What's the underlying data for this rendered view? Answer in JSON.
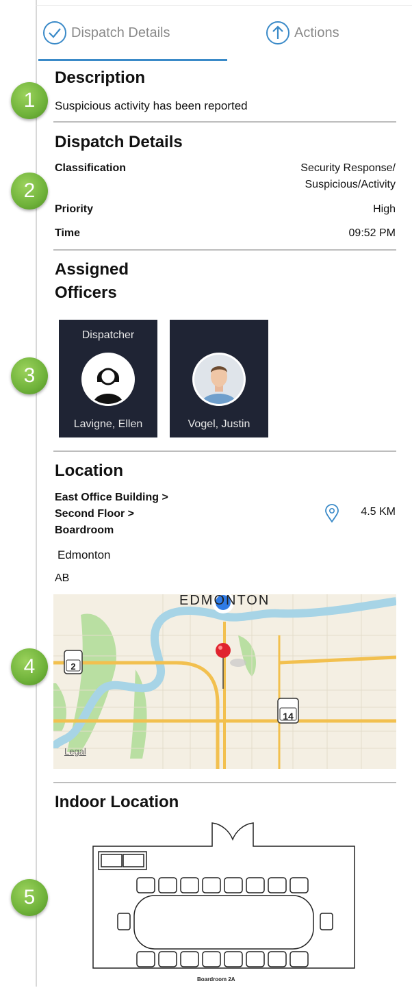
{
  "tabs": [
    {
      "label": "Dispatch Details",
      "icon": "check-circle-icon",
      "selected": true
    },
    {
      "label": "Actions",
      "icon": "arrow-up-circle-icon",
      "selected": false
    }
  ],
  "markers": [
    "1",
    "2",
    "3",
    "4",
    "5"
  ],
  "description": {
    "title": "Description",
    "text": "Suspicious activity has been reported"
  },
  "dispatch": {
    "title": "Dispatch Details",
    "classification_label": "Classification",
    "classification_value_1": "Security Response/",
    "classification_value_2": "Suspicious/Activity",
    "priority_label": "Priority",
    "priority_value": "High",
    "time_label": "Time",
    "time_value": "09:52 PM"
  },
  "officers": {
    "title_1": "Assigned",
    "title_2": "Officers",
    "list": [
      {
        "role": "Dispatcher",
        "name": "Lavigne, Ellen"
      },
      {
        "role": "",
        "name": "Vogel, Justin"
      }
    ]
  },
  "location": {
    "title": "Location",
    "path_1": "East Office Building >",
    "path_2": "Second Floor >",
    "path_3": "Boardroom",
    "distance": "4.5 KM",
    "city": "Edmonton",
    "province": "AB"
  },
  "map": {
    "city_label": "EDMONTON",
    "route_2": "2",
    "route_14": "14",
    "legal": "Legal",
    "road_color": "#f2c04f",
    "river_color": "#a7d4e6",
    "park_color": "#b9dfa2"
  },
  "indoor": {
    "title": "Indoor Location",
    "room_label": "Boardroom 2A"
  },
  "colors": {
    "accent": "#3a8ac8",
    "marker_green": "#6fb23a",
    "card_bg": "#1f2434",
    "pin_red": "#e0232e",
    "user_dot": "#2f7be5"
  }
}
